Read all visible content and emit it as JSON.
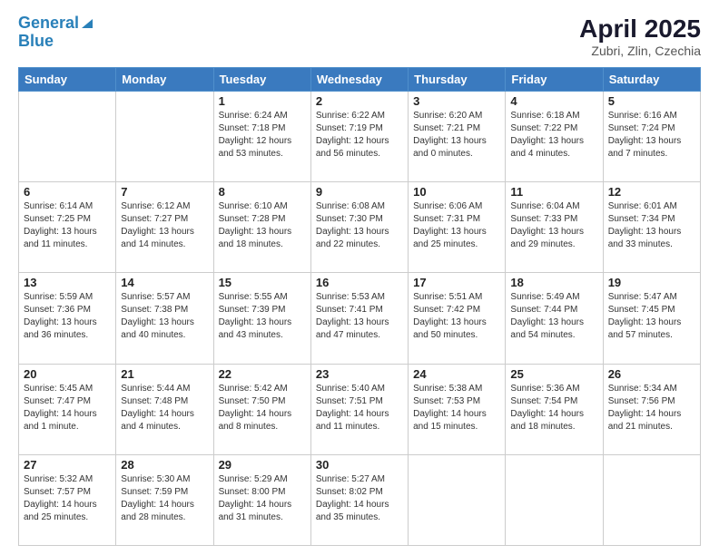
{
  "header": {
    "logo_line1": "General",
    "logo_line2": "Blue",
    "title": "April 2025",
    "subtitle": "Zubri, Zlin, Czechia"
  },
  "days_of_week": [
    "Sunday",
    "Monday",
    "Tuesday",
    "Wednesday",
    "Thursday",
    "Friday",
    "Saturday"
  ],
  "weeks": [
    [
      {
        "num": "",
        "info": ""
      },
      {
        "num": "",
        "info": ""
      },
      {
        "num": "1",
        "info": "Sunrise: 6:24 AM\nSunset: 7:18 PM\nDaylight: 12 hours and 53 minutes."
      },
      {
        "num": "2",
        "info": "Sunrise: 6:22 AM\nSunset: 7:19 PM\nDaylight: 12 hours and 56 minutes."
      },
      {
        "num": "3",
        "info": "Sunrise: 6:20 AM\nSunset: 7:21 PM\nDaylight: 13 hours and 0 minutes."
      },
      {
        "num": "4",
        "info": "Sunrise: 6:18 AM\nSunset: 7:22 PM\nDaylight: 13 hours and 4 minutes."
      },
      {
        "num": "5",
        "info": "Sunrise: 6:16 AM\nSunset: 7:24 PM\nDaylight: 13 hours and 7 minutes."
      }
    ],
    [
      {
        "num": "6",
        "info": "Sunrise: 6:14 AM\nSunset: 7:25 PM\nDaylight: 13 hours and 11 minutes."
      },
      {
        "num": "7",
        "info": "Sunrise: 6:12 AM\nSunset: 7:27 PM\nDaylight: 13 hours and 14 minutes."
      },
      {
        "num": "8",
        "info": "Sunrise: 6:10 AM\nSunset: 7:28 PM\nDaylight: 13 hours and 18 minutes."
      },
      {
        "num": "9",
        "info": "Sunrise: 6:08 AM\nSunset: 7:30 PM\nDaylight: 13 hours and 22 minutes."
      },
      {
        "num": "10",
        "info": "Sunrise: 6:06 AM\nSunset: 7:31 PM\nDaylight: 13 hours and 25 minutes."
      },
      {
        "num": "11",
        "info": "Sunrise: 6:04 AM\nSunset: 7:33 PM\nDaylight: 13 hours and 29 minutes."
      },
      {
        "num": "12",
        "info": "Sunrise: 6:01 AM\nSunset: 7:34 PM\nDaylight: 13 hours and 33 minutes."
      }
    ],
    [
      {
        "num": "13",
        "info": "Sunrise: 5:59 AM\nSunset: 7:36 PM\nDaylight: 13 hours and 36 minutes."
      },
      {
        "num": "14",
        "info": "Sunrise: 5:57 AM\nSunset: 7:38 PM\nDaylight: 13 hours and 40 minutes."
      },
      {
        "num": "15",
        "info": "Sunrise: 5:55 AM\nSunset: 7:39 PM\nDaylight: 13 hours and 43 minutes."
      },
      {
        "num": "16",
        "info": "Sunrise: 5:53 AM\nSunset: 7:41 PM\nDaylight: 13 hours and 47 minutes."
      },
      {
        "num": "17",
        "info": "Sunrise: 5:51 AM\nSunset: 7:42 PM\nDaylight: 13 hours and 50 minutes."
      },
      {
        "num": "18",
        "info": "Sunrise: 5:49 AM\nSunset: 7:44 PM\nDaylight: 13 hours and 54 minutes."
      },
      {
        "num": "19",
        "info": "Sunrise: 5:47 AM\nSunset: 7:45 PM\nDaylight: 13 hours and 57 minutes."
      }
    ],
    [
      {
        "num": "20",
        "info": "Sunrise: 5:45 AM\nSunset: 7:47 PM\nDaylight: 14 hours and 1 minute."
      },
      {
        "num": "21",
        "info": "Sunrise: 5:44 AM\nSunset: 7:48 PM\nDaylight: 14 hours and 4 minutes."
      },
      {
        "num": "22",
        "info": "Sunrise: 5:42 AM\nSunset: 7:50 PM\nDaylight: 14 hours and 8 minutes."
      },
      {
        "num": "23",
        "info": "Sunrise: 5:40 AM\nSunset: 7:51 PM\nDaylight: 14 hours and 11 minutes."
      },
      {
        "num": "24",
        "info": "Sunrise: 5:38 AM\nSunset: 7:53 PM\nDaylight: 14 hours and 15 minutes."
      },
      {
        "num": "25",
        "info": "Sunrise: 5:36 AM\nSunset: 7:54 PM\nDaylight: 14 hours and 18 minutes."
      },
      {
        "num": "26",
        "info": "Sunrise: 5:34 AM\nSunset: 7:56 PM\nDaylight: 14 hours and 21 minutes."
      }
    ],
    [
      {
        "num": "27",
        "info": "Sunrise: 5:32 AM\nSunset: 7:57 PM\nDaylight: 14 hours and 25 minutes."
      },
      {
        "num": "28",
        "info": "Sunrise: 5:30 AM\nSunset: 7:59 PM\nDaylight: 14 hours and 28 minutes."
      },
      {
        "num": "29",
        "info": "Sunrise: 5:29 AM\nSunset: 8:00 PM\nDaylight: 14 hours and 31 minutes."
      },
      {
        "num": "30",
        "info": "Sunrise: 5:27 AM\nSunset: 8:02 PM\nDaylight: 14 hours and 35 minutes."
      },
      {
        "num": "",
        "info": ""
      },
      {
        "num": "",
        "info": ""
      },
      {
        "num": "",
        "info": ""
      }
    ]
  ]
}
